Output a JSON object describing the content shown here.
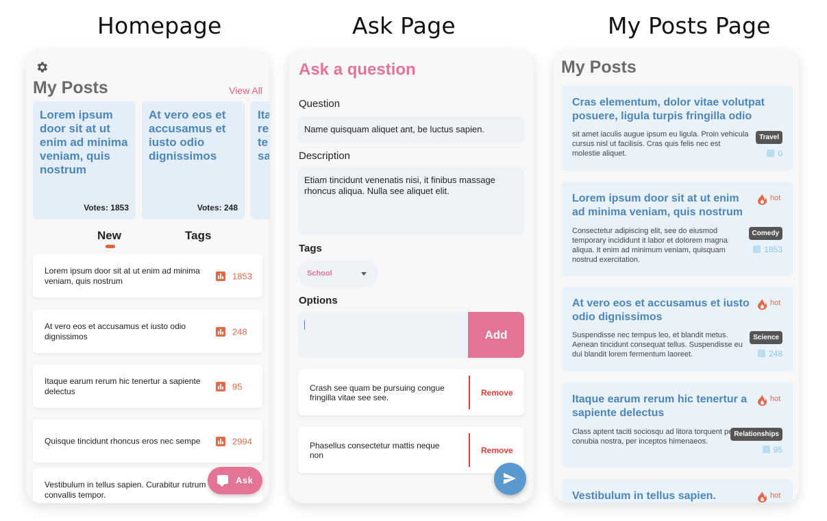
{
  "headings": {
    "home": "Homepage",
    "ask": "Ask Page",
    "posts": "My Posts Page"
  },
  "home": {
    "title": "My Posts",
    "view_all": "View All",
    "cards": [
      {
        "title": "Lorem ipsum door sit at ut enim ad minima veniam, quis nostrum",
        "votes": "Votes: 1853"
      },
      {
        "title": "At vero eos et accusamus et iusto odio dignissimos",
        "votes": "Votes: 248"
      },
      {
        "title": "Ita re te sa",
        "votes": ""
      }
    ],
    "tabs": [
      "New",
      "Tags"
    ],
    "items": [
      {
        "text": "Lorem ipsum door sit at ut enim ad minima veniam, quis nostrum",
        "count": "1853"
      },
      {
        "text": "At vero eos et accusamus et iusto odio dignissimos",
        "count": "248"
      },
      {
        "text": "Itaque earum rerum hic tenertur a sapiente delectus",
        "count": "95"
      },
      {
        "text": "Quisque tincidunt rhoncus eros nec sempe",
        "count": "2994"
      },
      {
        "text": "Vestibulum in tellus sapien. Curabitur rutrum convallis tempor.",
        "count": ""
      }
    ],
    "ask_button": "Ask"
  },
  "ask": {
    "title": "Ask a question",
    "question_label": "Question",
    "question_value": "Name quisquam aliquet ant, be luctus sapien.",
    "description_label": "Description",
    "description_value": "Etiam tincidunt venenatis nisi, it finibus massage rhoncus aliqua. Nulla see aliquet elit.",
    "tags_label": "Tags",
    "tag_selected": "School",
    "options_label": "Options",
    "option_input_value": "",
    "add_button": "Add",
    "options": [
      {
        "text": "Crash see quam be pursuing congue fringilla vitae see see.",
        "remove": "Remove"
      },
      {
        "text": "Phasellus consectetur mattis neque non",
        "remove": "Remove"
      }
    ]
  },
  "posts": {
    "title": "My Posts",
    "hot_label": "hot",
    "items": [
      {
        "title": "Cras elementum, dolor vitae volutpat posuere, ligula turpis fringilla odio",
        "desc": "sit amet iaculis augue ipsum eu ligula. Proin vehicula cursus nisl ut facilisis. Cras quis felis nec est molestie aliquet.",
        "tag": "Travel",
        "count": "0",
        "hot": false
      },
      {
        "title": "Lorem ipsum door sit at ut enim ad minima veniam, quis nostrum",
        "desc": "Consectetur adipiscing elit, see do eiusmod temporary incididunt it labor et dolorem magna aliqua. It enim ad minimum veniam, quisquam nostrud exercitation.",
        "tag": "Comedy",
        "count": "1853",
        "hot": true
      },
      {
        "title": "At vero eos et accusamus et iusto odio dignissimos",
        "desc": "Suspendisse nec tempus leo, et blandit metus. Aenean tincidunt consequat tellus. Suspendisse eu dui blandit lorem fermentum laoreet.",
        "tag": "Science",
        "count": "248",
        "hot": true
      },
      {
        "title": "Itaque earum rerum hic tenertur a sapiente delectus",
        "desc": "Class aptent taciti sociosqu ad litora torquent per conubia nostra, per inceptos himenaeos.",
        "tag": "Relationships",
        "count": "95",
        "hot": true
      },
      {
        "title": "Vestibulum in tellus sapien.",
        "desc": "",
        "tag": "",
        "count": "",
        "hot": true
      }
    ]
  },
  "colors": {
    "accent_pink": "#e47495",
    "blue_title": "#4c86b9",
    "orange": "#e4694b",
    "remove_red": "#e23b3b"
  }
}
